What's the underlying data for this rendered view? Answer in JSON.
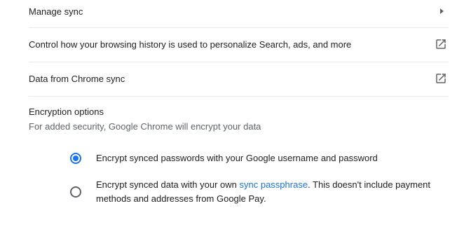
{
  "rows": {
    "manage_sync": "Manage sync",
    "browsing_history": "Control how your browsing history is used to personalize Search, ads, and more",
    "data_from_sync": "Data from Chrome sync"
  },
  "encryption": {
    "title": "Encryption options",
    "subtitle": "For added security, Google Chrome will encrypt your data",
    "option1": "Encrypt synced passwords with your Google username and password",
    "option2_before": "Encrypt synced data with your own ",
    "option2_link": "sync passphrase",
    "option2_after": ". This doesn't include payment methods and addresses from Google Pay.",
    "selected_option": 1
  },
  "icons": {
    "manage_sync": "chevron-right-icon",
    "browsing_history": "open-in-new-icon",
    "data_from_sync": "open-in-new-icon"
  },
  "colors": {
    "accent": "#1a73e8",
    "text": "#202124",
    "secondary_text": "#5f6368",
    "divider": "#e8eaed"
  }
}
